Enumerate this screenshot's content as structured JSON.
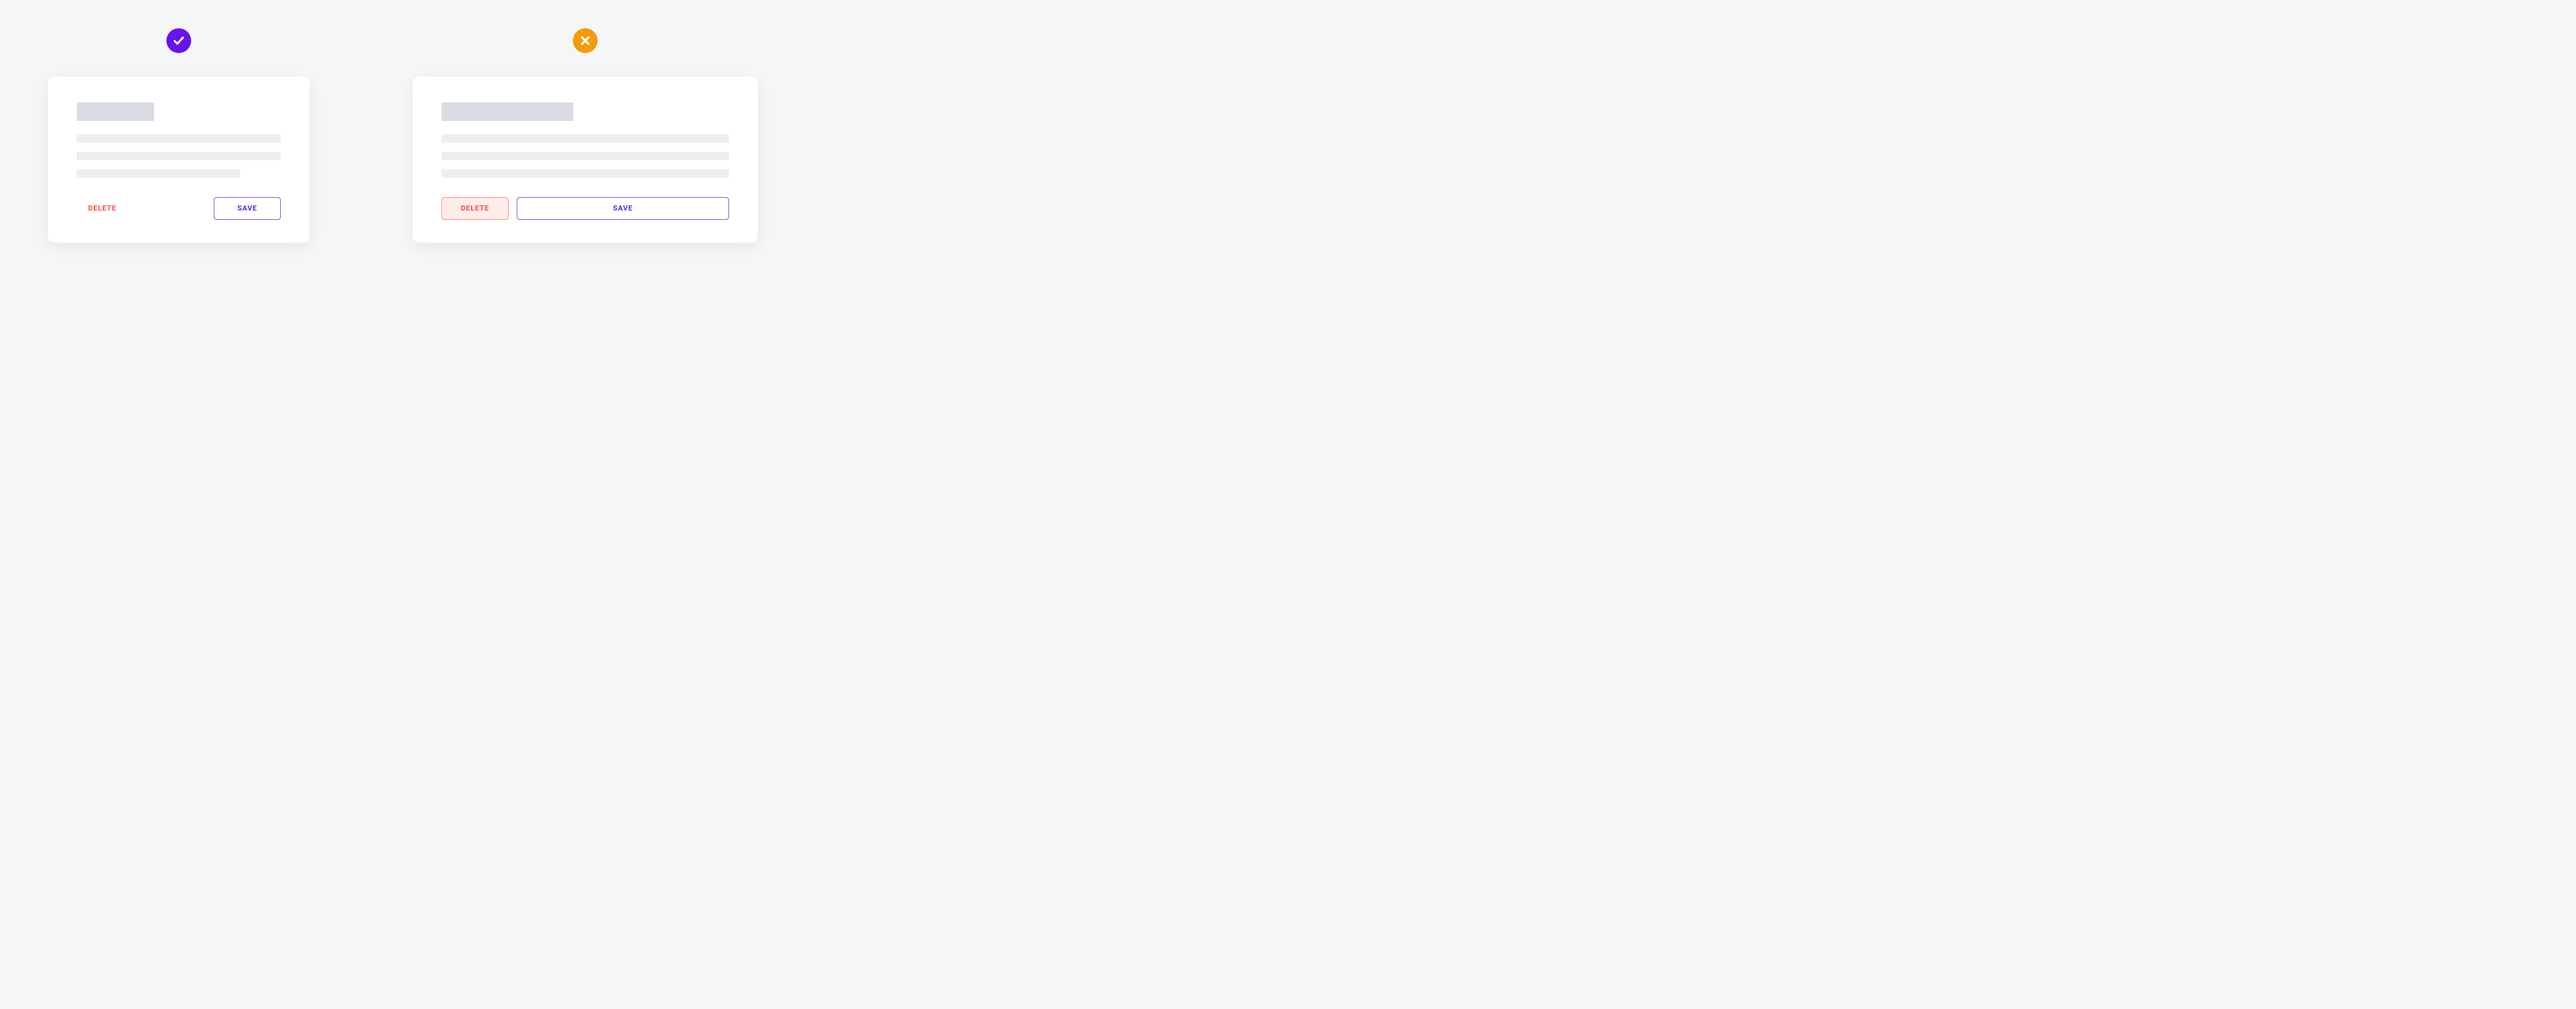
{
  "good_example": {
    "badge": "check-icon",
    "delete_label": "DELETE",
    "save_label": "SAVE"
  },
  "bad_example": {
    "badge": "cross-icon",
    "delete_label": "DELETE",
    "save_label": "SAVE"
  },
  "colors": {
    "good_badge": "#6514ED",
    "bad_badge": "#F59B0B",
    "delete": "#FF4438",
    "save": "#5B21E0",
    "skeleton_title": "#d8dce2",
    "skeleton_line": "#eceef1"
  }
}
